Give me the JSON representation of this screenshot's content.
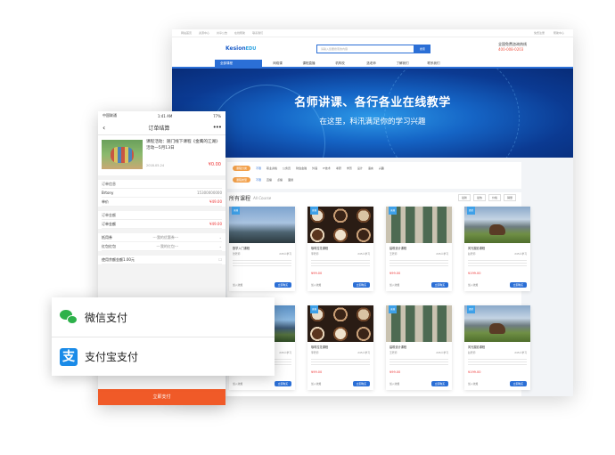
{
  "desktop": {
    "topbar": {
      "left": [
        "网站首页",
        "资源中心",
        "共享公告",
        "在线帮助",
        "联系我们"
      ],
      "right": [
        "免费注册",
        "帮助中心"
      ]
    },
    "logo_main": "Kesion",
    "logo_sub": "EDU",
    "search_placeholder": "请输入您要搜索的内容",
    "search_button": "搜索",
    "hotline_label": "全国免费咨询热线",
    "hotline_number": "400-008-0203",
    "nav_category": "全部课程",
    "nav_items": [
      "网络课",
      "课程直播",
      "机构校",
      "选老师",
      "了解我们",
      "联系我们"
    ],
    "banner_title": "名师讲课、各行各业在线教学",
    "banner_subtitle": "在这里，科汛满足你的学习兴趣",
    "filter_pill_1": "课程分类",
    "filter_pill_2": "课程类型",
    "filter_options_1": [
      "不限",
      "职业资格",
      "公务员",
      "财会金融",
      "外语",
      "IT技术",
      "考研",
      "学历",
      "设计",
      "语言",
      "兴趣"
    ],
    "filter_options_2": [
      "不限",
      "直播",
      "点播",
      "面授"
    ],
    "section_title": "所有课程",
    "section_en": "All Course",
    "sorts": [
      "最新",
      "最热",
      "价格",
      "销量"
    ],
    "cards": [
      {
        "tag": "录播",
        "name": "数学入门课程",
        "learners": "245人学习",
        "teacher": "张老师",
        "price": "",
        "fav": "加入收藏",
        "buy": "立即购买"
      },
      {
        "tag": "直播",
        "name": "咖啡拉花课程",
        "learners": "245人学习",
        "teacher": "李老师",
        "price": "¥99.00",
        "fav": "加入收藏",
        "buy": "立即购买"
      },
      {
        "tag": "录播",
        "name": "建筑设计课程",
        "learners": "245人学习",
        "teacher": "王老师",
        "price": "¥99.00",
        "fav": "加入收藏",
        "buy": "立即购买"
      },
      {
        "tag": "面授",
        "name": "风光摄影课程",
        "learners": "245人学习",
        "teacher": "赵老师",
        "price": "¥199.00",
        "fav": "加入收藏",
        "buy": "立即购买"
      },
      {
        "tag": "录播",
        "name": "数学入门课程",
        "learners": "245人学习",
        "teacher": "张老师",
        "price": "",
        "fav": "加入收藏",
        "buy": "立即购买"
      },
      {
        "tag": "直播",
        "name": "咖啡拉花课程",
        "learners": "245人学习",
        "teacher": "李老师",
        "price": "¥99.00",
        "fav": "加入收藏",
        "buy": "立即购买"
      },
      {
        "tag": "录播",
        "name": "建筑设计课程",
        "learners": "245人学习",
        "teacher": "王老师",
        "price": "¥99.00",
        "fav": "加入收藏",
        "buy": "立即购买"
      },
      {
        "tag": "面授",
        "name": "风光摄影课程",
        "learners": "245人学习",
        "teacher": "赵老师",
        "price": "¥199.00",
        "fav": "加入收藏",
        "buy": "立即购买"
      }
    ]
  },
  "mobile": {
    "carrier": "中国联通",
    "time": "1:41 AM",
    "battery": "77%",
    "title": "订单结算",
    "order_name": "课程活动：随门线下课程《金鹰的江湖》活动一5月13日",
    "order_date": "2018.05.24",
    "order_price": "¥0.00",
    "info_head": "订单信息",
    "user_name": "Brtony",
    "user_phone": "15300000000",
    "course_price_label": "单价",
    "course_price": "¥49.00",
    "amount_head": "订单金额",
    "amount_label": "订单金额",
    "amount_value": "¥49.00",
    "coupon_label": "抵用券",
    "coupon_value": "---我的优惠券---",
    "redpack_label": "红包红包",
    "redpack_value": "---我的红包---",
    "balance_label": "使用余额金额1.00元",
    "pay_button": "立即支付"
  },
  "payment": {
    "wechat": "微信支付",
    "alipay": "支付宝支付"
  }
}
